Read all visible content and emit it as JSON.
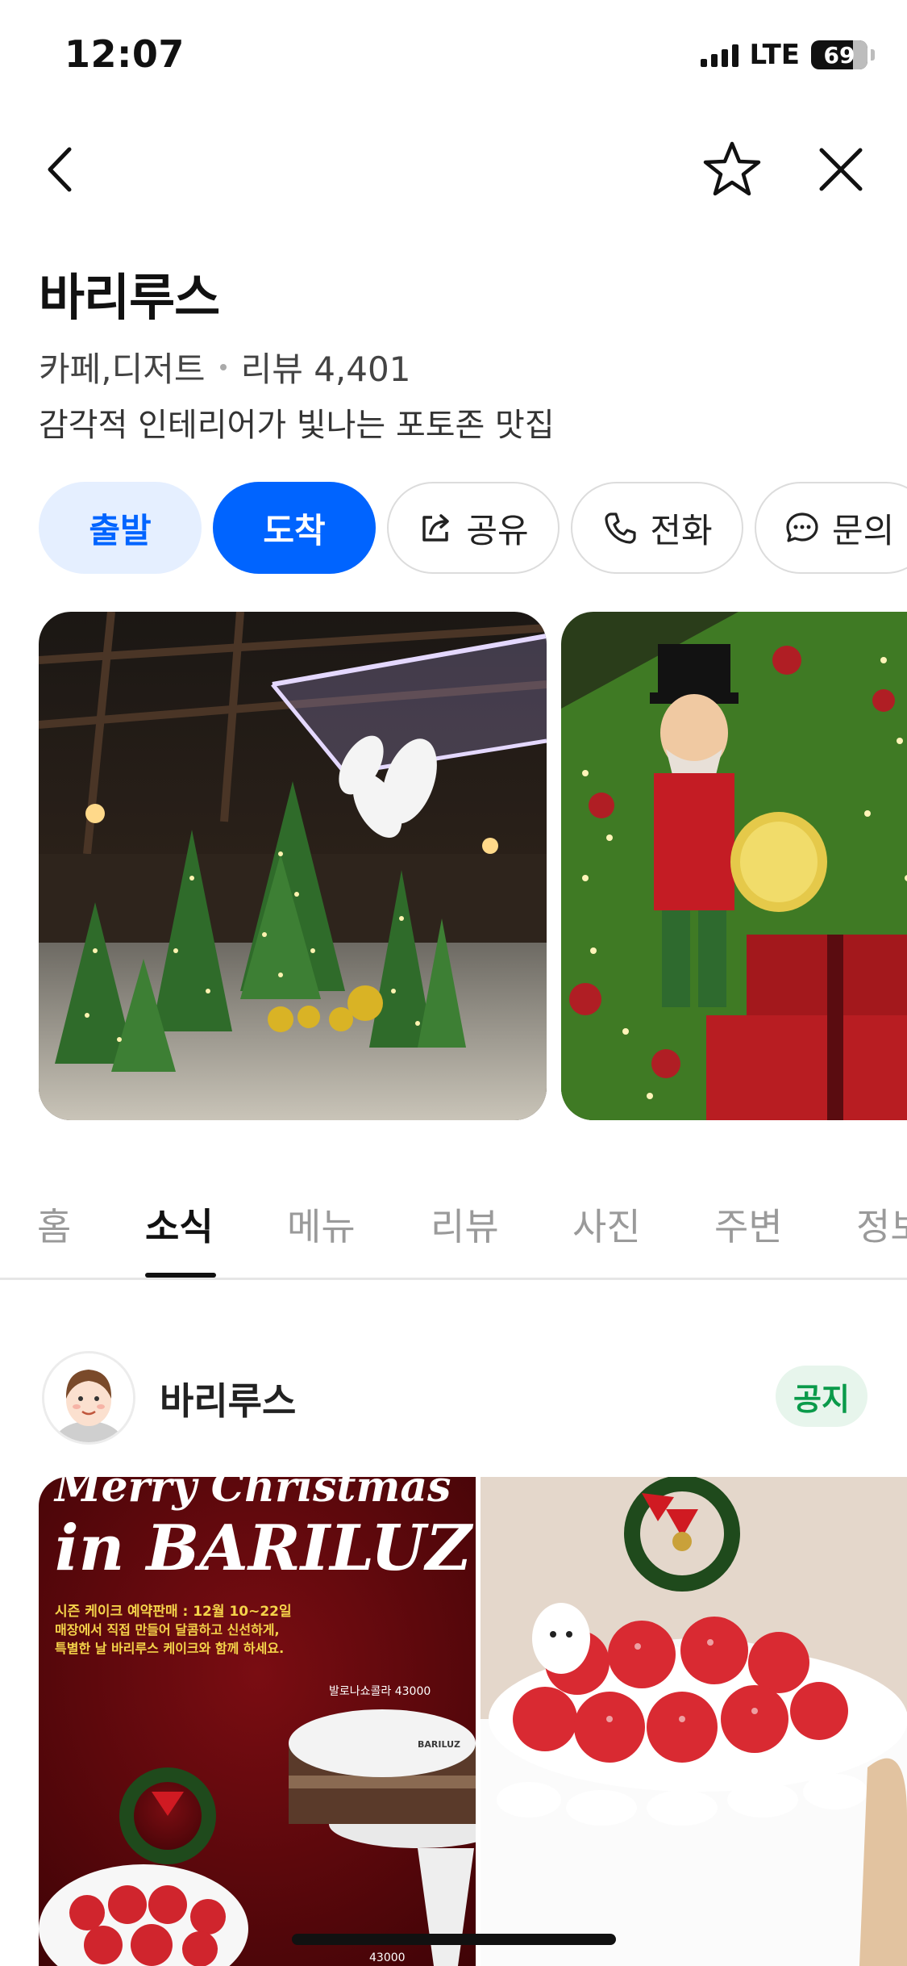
{
  "status_bar": {
    "time": "12:07",
    "network": "LTE",
    "battery": "69"
  },
  "place": {
    "name": "바리루스",
    "category": "카페,디저트",
    "review_label": "리뷰 4,401",
    "description": "감각적 인테리어가 빛나는 포토존 맛집"
  },
  "actions": {
    "depart": "출발",
    "arrive": "도착",
    "share": "공유",
    "call": "전화",
    "ask": "문의"
  },
  "tabs": [
    "홈",
    "소식",
    "메뉴",
    "리뷰",
    "사진",
    "주변",
    "정보"
  ],
  "active_tab": "소식",
  "post": {
    "author": "바리루스",
    "badge": "공지",
    "poster_title_1": "Merry Christmas",
    "poster_title_2": "in BARILUZ",
    "poster_line_1": "시즌 케이크 예약판매 : 12월 10~22일",
    "poster_line_2": "매장에서 직접 만들어 달콤하고 신선하게,",
    "poster_line_3": "특별한 날 바리루스 케이크와 함께 하세요.",
    "poster_price_1": "발로나쇼콜라 43000",
    "poster_price_2": "43000",
    "cake_brand": "BARILUZ"
  },
  "colors": {
    "primary": "#0064ff",
    "primary_light": "#e5efff",
    "notice_green": "#0a9a4a",
    "notice_bg": "#e7f5ec"
  }
}
